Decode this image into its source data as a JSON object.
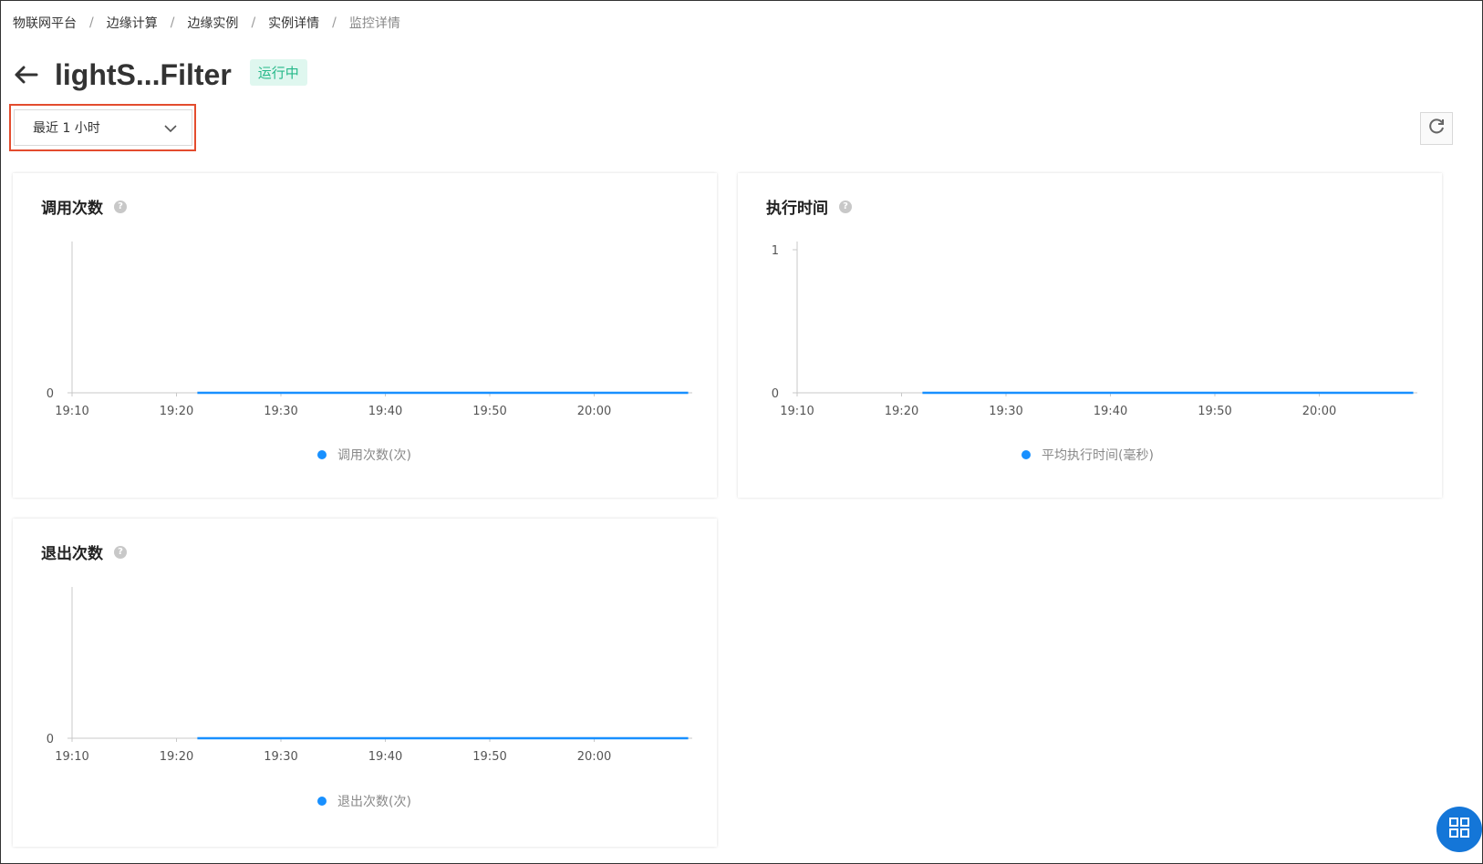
{
  "breadcrumb": {
    "items": [
      "物联网平台",
      "边缘计算",
      "边缘实例",
      "实例详情"
    ],
    "current": "监控详情",
    "separator": "/"
  },
  "header": {
    "title": "lightS...Filter",
    "status": "运行中"
  },
  "time_select": {
    "value": "最近 1 小时"
  },
  "colors": {
    "series": "#1890ff",
    "status_text": "#25b889",
    "highlight": "#e34c2e"
  },
  "icons": {
    "back": "arrow-left-icon",
    "refresh": "refresh-icon",
    "help": "question-circle-icon",
    "fab": "grid-icon",
    "dropdown": "chevron-down-icon"
  },
  "charts": [
    {
      "title": "调用次数",
      "legend": "调用次数(次)"
    },
    {
      "title": "执行时间",
      "legend": "平均执行时间(毫秒)"
    },
    {
      "title": "退出次数",
      "legend": "退出次数(次)"
    }
  ],
  "chart_data": [
    {
      "type": "line",
      "title": "调用次数",
      "x_ticks": [
        "19:10",
        "19:20",
        "19:30",
        "19:40",
        "19:50",
        "20:00"
      ],
      "y_ticks": [
        "0"
      ],
      "series": [
        {
          "name": "调用次数(次)",
          "x": [
            "19:22",
            "20:09"
          ],
          "values": [
            0,
            0
          ]
        }
      ],
      "legend_position": "bottom",
      "grid": false
    },
    {
      "type": "line",
      "title": "执行时间",
      "x_ticks": [
        "19:10",
        "19:20",
        "19:30",
        "19:40",
        "19:50",
        "20:00"
      ],
      "y_ticks": [
        "0",
        "1"
      ],
      "ylim": [
        0,
        1
      ],
      "series": [
        {
          "name": "平均执行时间(毫秒)",
          "x": [
            "19:22",
            "20:09"
          ],
          "values": [
            0,
            0
          ]
        }
      ],
      "legend_position": "bottom",
      "grid": false
    },
    {
      "type": "line",
      "title": "退出次数",
      "x_ticks": [
        "19:10",
        "19:20",
        "19:30",
        "19:40",
        "19:50",
        "20:00"
      ],
      "y_ticks": [
        "0"
      ],
      "series": [
        {
          "name": "退出次数(次)",
          "x": [
            "19:22",
            "20:09"
          ],
          "values": [
            0,
            0
          ]
        }
      ],
      "legend_position": "bottom",
      "grid": false
    }
  ]
}
